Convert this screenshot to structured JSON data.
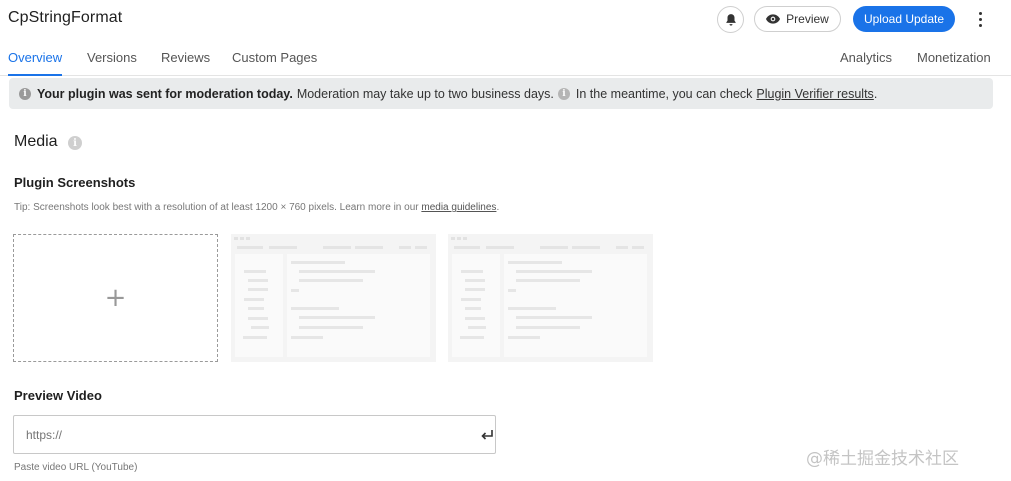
{
  "header": {
    "title": "CpStringFormat",
    "preview_label": "Preview",
    "upload_label": "Upload Update"
  },
  "tabs": {
    "overview": "Overview",
    "versions": "Versions",
    "reviews": "Reviews",
    "custom_pages": "Custom Pages",
    "analytics": "Analytics",
    "monetization": "Monetization"
  },
  "banner": {
    "bold_text": "Your plugin was sent for moderation today.",
    "text": "Moderation may take up to two business days.",
    "text2": "In the meantime, you can check",
    "link": "Plugin Verifier results",
    "end": "."
  },
  "media": {
    "title": "Media",
    "screenshots_title": "Plugin Screenshots",
    "tip_text": "Tip: Screenshots look best with a resolution of at least 1200 × 760 pixels. Learn more in our",
    "tip_link": "media guidelines",
    "tip_end": ".",
    "add_symbol": "+",
    "video_title": "Preview Video",
    "video_placeholder": "https://",
    "video_hint": "Paste video URL (YouTube)"
  },
  "icons": {
    "bell": "bell-icon",
    "eye": "eye-icon",
    "more": "more-vertical-icon",
    "info": "info-icon",
    "enter": "enter-return-icon"
  },
  "colors": {
    "accent": "#1a73e8",
    "banner_bg": "#e9ebec"
  },
  "watermark": "@稀土掘金技术社区"
}
